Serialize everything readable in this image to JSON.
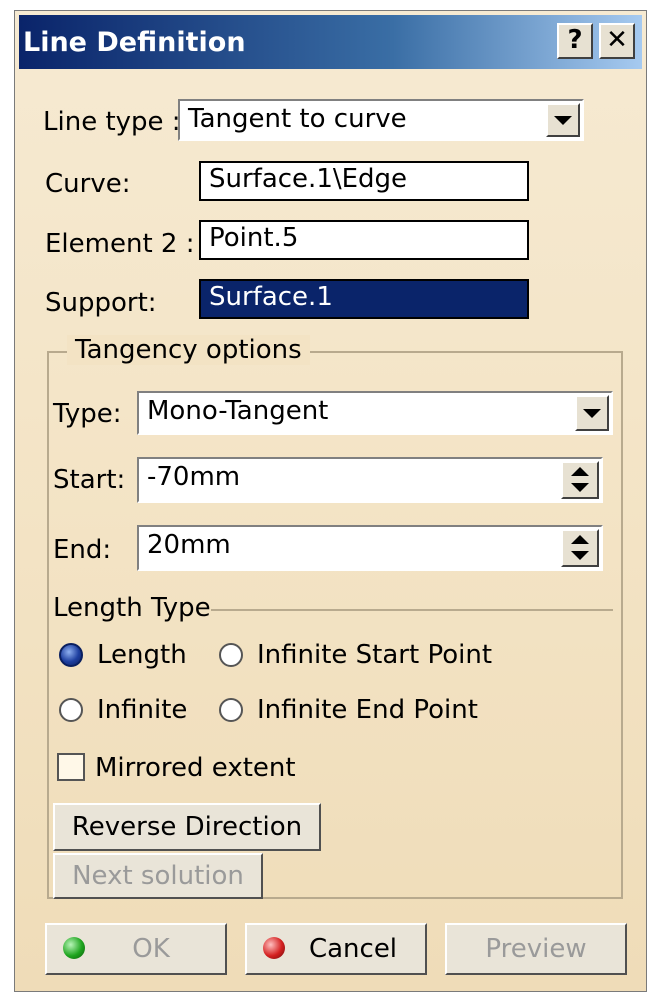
{
  "window": {
    "title": "Line Definition",
    "help_label": "?",
    "close_label": "✕"
  },
  "line_type": {
    "label": "Line type :",
    "value": "Tangent to curve"
  },
  "curve": {
    "label": "Curve:",
    "value": "Surface.1\\Edge"
  },
  "element2": {
    "label": "Element 2 :",
    "value": "Point.5"
  },
  "support": {
    "label": "Support:",
    "value": "Surface.1"
  },
  "tangency": {
    "legend": "Tangency options",
    "type": {
      "label": "Type:",
      "value": "Mono-Tangent"
    },
    "start": {
      "label": "Start:",
      "value": "-70mm"
    },
    "end": {
      "label": "End:",
      "value": "20mm"
    },
    "length_type": {
      "legend": "Length Type",
      "options": [
        {
          "label": "Length",
          "selected": true
        },
        {
          "label": "Infinite Start Point",
          "selected": false
        },
        {
          "label": "Infinite",
          "selected": false
        },
        {
          "label": "Infinite End Point",
          "selected": false
        }
      ]
    },
    "mirrored": {
      "label": "Mirrored extent",
      "checked": false
    },
    "reverse_label": "Reverse Direction",
    "next_label": "Next solution"
  },
  "footer": {
    "ok_label": "OK",
    "cancel_label": "Cancel",
    "preview_label": "Preview"
  },
  "colors": {
    "title_bar": "#0a246a",
    "selected_field": "#0a246a",
    "ok_icon": "#1fa51f",
    "cancel_icon": "#d42020"
  }
}
